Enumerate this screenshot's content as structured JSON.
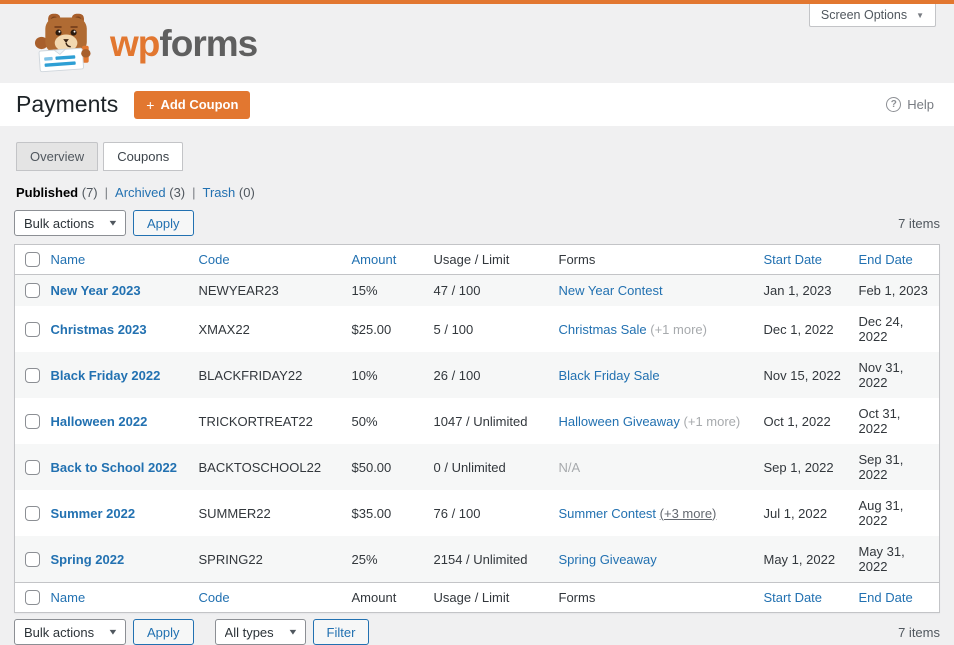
{
  "screen_options": {
    "label": "Screen Options",
    "arrow": "▼"
  },
  "brand": {
    "wp": "wp",
    "forms": "forms"
  },
  "page_header": {
    "title": "Payments",
    "plus": "+",
    "add_coupon": "Add Coupon",
    "help_glyph": "?",
    "help": "Help"
  },
  "tabs": {
    "overview": "Overview",
    "coupons": "Coupons"
  },
  "filters": {
    "published_label": "Published",
    "published_count": "(7)",
    "archived_label": "Archived",
    "archived_count": "(3)",
    "trash_label": "Trash",
    "trash_count": "(0)",
    "separator": "|"
  },
  "toolbar": {
    "bulk_actions": "Bulk actions",
    "apply": "Apply",
    "all_types": "All types",
    "filter": "Filter",
    "items_count": "7 items",
    "chevron": "▼"
  },
  "table": {
    "columns": {
      "name": "Name",
      "code": "Code",
      "amount": "Amount",
      "usage": "Usage / Limit",
      "forms": "Forms",
      "start": "Start Date",
      "end": "End Date"
    },
    "rows": [
      {
        "name": "New Year 2023",
        "code": "NEWYEAR23",
        "amount": "15%",
        "usage": "47 / 100",
        "form": "New Year Contest",
        "form_more": "",
        "start": "Jan 1, 2023",
        "end": "Feb 1, 2023"
      },
      {
        "name": "Christmas 2023",
        "code": "XMAX22",
        "amount": "$25.00",
        "usage": "5 / 100",
        "form": "Christmas Sale",
        "form_more": "(+1 more)",
        "start": "Dec 1, 2022",
        "end": "Dec 24, 2022"
      },
      {
        "name": "Black Friday 2022",
        "code": "BLACKFRIDAY22",
        "amount": "10%",
        "usage": "26 / 100",
        "form": "Black Friday Sale",
        "form_more": "",
        "start": "Nov 15, 2022",
        "end": "Nov 31, 2022"
      },
      {
        "name": "Halloween 2022",
        "code": "TRICKORTREAT22",
        "amount": "50%",
        "usage": "1047 / Unlimited",
        "form": "Halloween Giveaway",
        "form_more": "(+1 more)",
        "start": "Oct 1, 2022",
        "end": "Oct 31, 2022"
      },
      {
        "name": "Back to School 2022",
        "code": "BACKTOSCHOOL22",
        "amount": "$50.00",
        "usage": "0 / Unlimited",
        "form": "N/A",
        "form_more": "",
        "start": "Sep 1, 2022",
        "end": "Sep 31, 2022"
      },
      {
        "name": "Summer 2022",
        "code": "SUMMER22",
        "amount": "$35.00",
        "usage": "76 / 100",
        "form": "Summer Contest",
        "form_more": "(+3 more)",
        "start": "Jul 1, 2022",
        "end": "Aug 31, 2022"
      },
      {
        "name": "Spring 2022",
        "code": "SPRING22",
        "amount": "25%",
        "usage": "2154 / Unlimited",
        "form": "Spring Giveaway",
        "form_more": "",
        "start": "May 1, 2022",
        "end": "May 31, 2022"
      }
    ]
  },
  "colors": {
    "accent_orange": "#e27730",
    "link_blue": "#2271b1",
    "text_dark": "#32373c",
    "muted_gray": "#a7aaad",
    "border": "#c3c4c7",
    "row_stripe": "#f6f7f7",
    "page_bg": "#f0f0f1"
  }
}
